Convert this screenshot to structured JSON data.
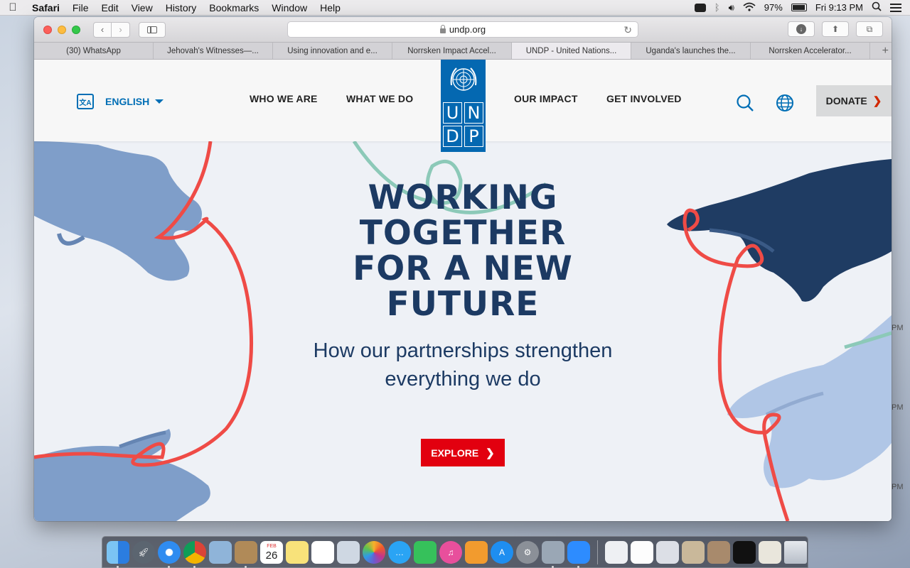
{
  "menubar": {
    "app": "Safari",
    "items": [
      "File",
      "Edit",
      "View",
      "History",
      "Bookmarks",
      "Window",
      "Help"
    ],
    "battery": "97%",
    "clock": "Fri 9:13 PM"
  },
  "browser": {
    "url": "undp.org",
    "tabs": [
      "(30) WhatsApp",
      "Jehovah's Witnesses—...",
      "Using innovation and e...",
      "Norrsken Impact Accel...",
      "UNDP - United Nations...",
      "Uganda's launches the...",
      "Norrsken Accelerator..."
    ],
    "active_tab": 4
  },
  "site": {
    "language": "ENGLISH",
    "nav": [
      "WHO WE ARE",
      "WHAT WE DO",
      "OUR IMPACT",
      "GET INVOLVED"
    ],
    "logo_letters": [
      "U",
      "N",
      "D",
      "P"
    ],
    "donate": "DONATE",
    "hero": {
      "headline": [
        "WORKING",
        "TOGETHER",
        "FOR A NEW",
        "FUTURE"
      ],
      "subhead": [
        "How our partnerships strengthen",
        "everything we do"
      ],
      "cta": "EXPLORE"
    },
    "colors": {
      "brand_blue": "#0468b1",
      "headline": "#1c3a63",
      "cta_red": "#e2000f",
      "thread_red": "#ef4b46",
      "thread_teal": "#8cc9b8"
    }
  },
  "desktop": {
    "side_clock_labels": [
      "PM",
      "PM",
      "PM"
    ],
    "calendar_month": "FEB",
    "calendar_day": "26"
  },
  "dock": {
    "apps": [
      "finder-icon",
      "launchpad-icon",
      "safari-icon",
      "chrome-icon",
      "preview-icon",
      "contacts-icon",
      "calendar-icon",
      "notes-icon",
      "reminders-icon",
      "photo-viewer-icon",
      "photos-icon",
      "messages-icon",
      "facetime-icon",
      "itunes-icon",
      "ibooks-icon",
      "app-store-icon",
      "system-preferences-icon",
      "image-capture-icon",
      "zoom-icon"
    ],
    "files": [
      "document-icon",
      "screenshot-1-icon",
      "screenshot-2-icon",
      "screenshot-3-icon",
      "screenshot-4-icon",
      "screenshot-5-icon",
      "screenshot-6-icon",
      "trash-icon"
    ]
  }
}
